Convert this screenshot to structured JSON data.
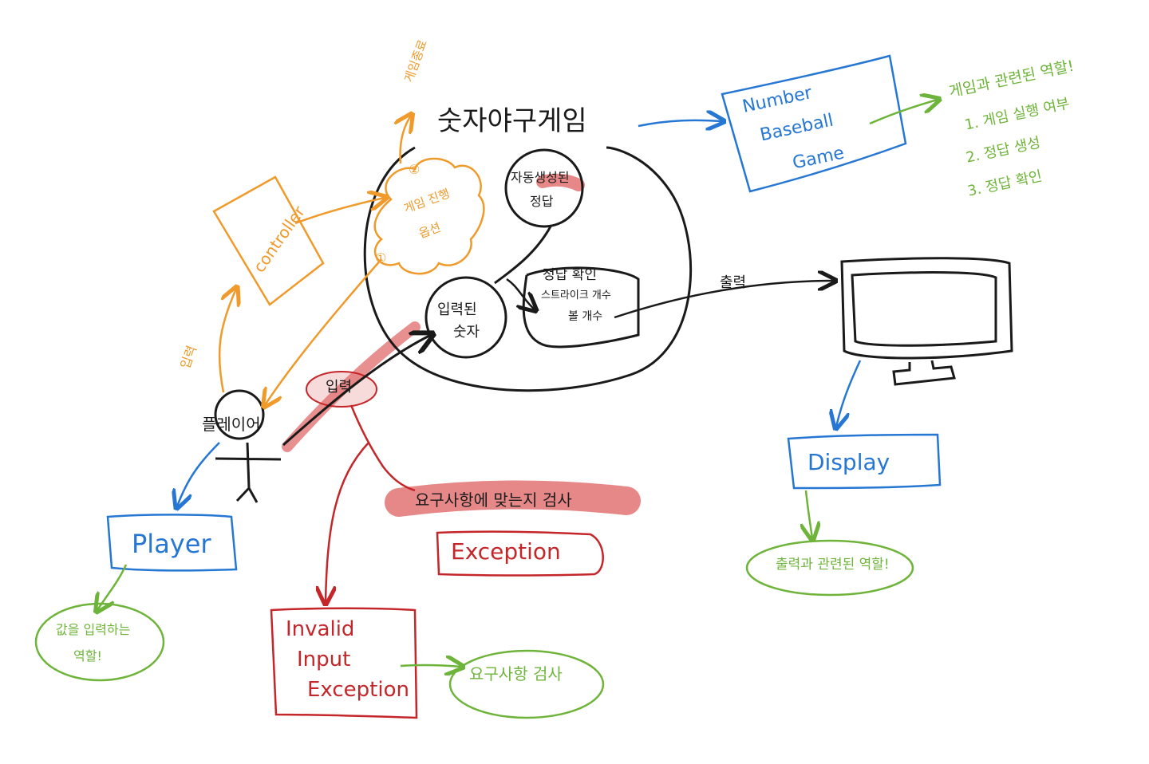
{
  "colors": {
    "ink": "#1a1a1a",
    "orange": "#ef9a2b",
    "blue": "#2677d3",
    "green": "#6fb43a",
    "red": "#c4262a",
    "highlight": "#e06a6a"
  },
  "main_circle": {
    "title": "숫자야구게임",
    "generated_answer": [
      "자동생성된",
      "정답"
    ],
    "input_number": [
      "입력된",
      "숫자"
    ],
    "check_box": [
      "정답 확인",
      "스트라이크 개수",
      "볼 개수"
    ]
  },
  "game_end": "게임종료",
  "cloud": {
    "marker_top": "②",
    "marker_bottom": "①",
    "text": [
      "게임 진행",
      "옵션"
    ]
  },
  "controller": {
    "label": "controller"
  },
  "player": {
    "figure_label": "플레이어"
  },
  "arrows": {
    "input_to_controller": "입력",
    "input_to_number": "입력",
    "output": "출력"
  },
  "number_baseball_game": {
    "box": [
      "Number",
      "Baseball",
      "Game"
    ],
    "roles": [
      "게임과 관련된 역할!",
      "1. 게임 실행 여부",
      "2. 정답 생성",
      "3. 정답 확인"
    ]
  },
  "display": {
    "box": "Display",
    "role": "출력과 관련된 역할!"
  },
  "player_class": {
    "box": "Player",
    "role": [
      "값을 입력하는",
      "역할!"
    ]
  },
  "requirement_check": "요구사항에 맞는지 검사",
  "exception": {
    "box": "Exception"
  },
  "invalid_input_exception": {
    "box": [
      "Invalid",
      "Input",
      "Exception"
    ],
    "role": "요구사항 검사"
  }
}
